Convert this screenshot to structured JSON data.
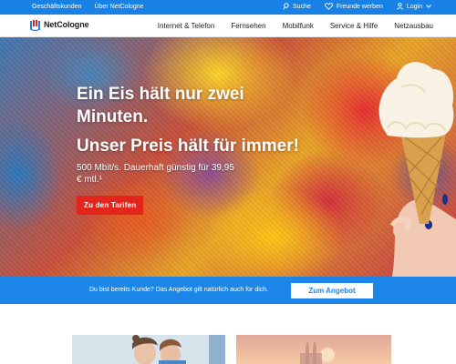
{
  "topbar": {
    "links": [
      "Geschäftskunden",
      "Über NetCologne"
    ],
    "search": "Suche",
    "referral": "Freunde werben",
    "login": "Login"
  },
  "brand": {
    "name": "NetCologne"
  },
  "nav": {
    "items": [
      "Internet & Telefon",
      "Fernsehen",
      "Mobilfunk",
      "Service & Hilfe",
      "Netzausbau"
    ]
  },
  "hero": {
    "title": "Ein Eis hält nur zwei Minuten.",
    "subtitle": "Unser Preis hält für immer!",
    "text": "500 Mbit/s. Dauerhaft günstig für 39,95 € mtl.¹",
    "button": "Zu den Tarifen"
  },
  "infobar": {
    "text": "Du bist bereits Kunde? Das Angebot gilt natürlich auch für dich.",
    "button": "Zum Angebot"
  },
  "colors": {
    "primary_blue": "#1781e6",
    "accent_red": "#e4251b",
    "white": "#ffffff"
  }
}
